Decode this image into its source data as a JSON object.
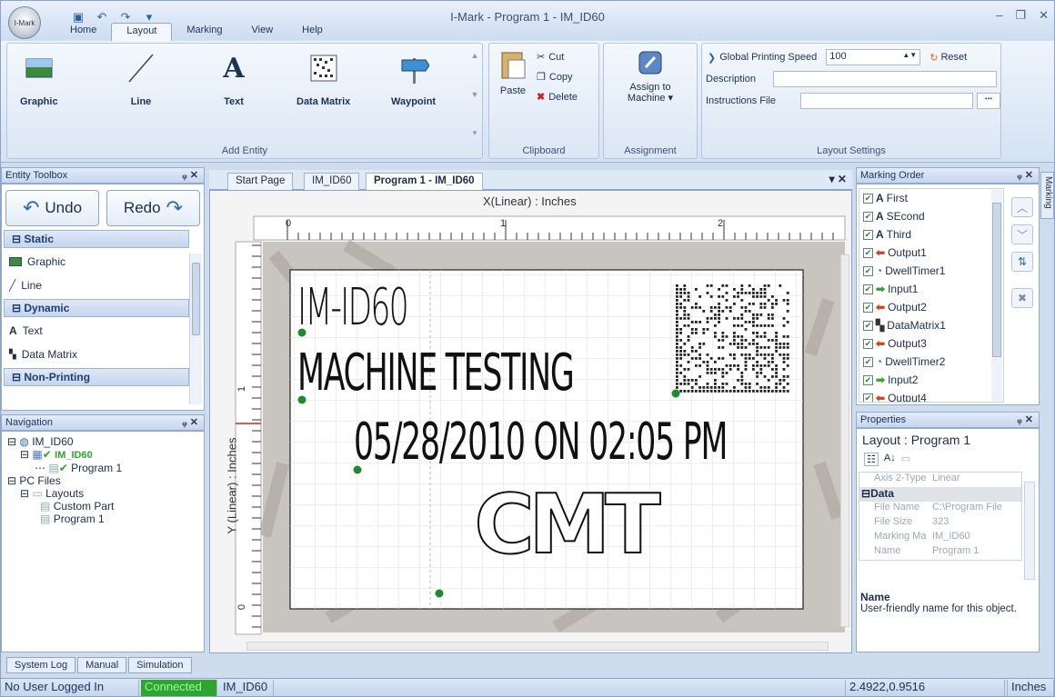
{
  "window": {
    "title": "I-Mark - Program 1 - IM_ID60",
    "orb_label": "I-Mark"
  },
  "tabs": [
    "Home",
    "Layout",
    "Marking",
    "View",
    "Help"
  ],
  "ribbon": {
    "add_entity": {
      "title": "Add Entity",
      "buttons": [
        "Graphic",
        "Line",
        "Text",
        "Data Matrix",
        "Waypoint"
      ]
    },
    "clipboard": {
      "title": "Clipboard",
      "paste": "Paste",
      "cut": "Cut",
      "copy": "Copy",
      "delete": "Delete"
    },
    "assignment": {
      "title": "Assignment",
      "assign_line1": "Assign to",
      "assign_line2": "Machine ▾"
    },
    "layout_settings": {
      "title": "Layout Settings",
      "speed_label": "Global Printing Speed",
      "speed_value": "100",
      "reset": "Reset",
      "description_label": "Description",
      "instructions_label": "Instructions File",
      "browse": "•••"
    }
  },
  "entity_toolbox": {
    "title": "Entity Toolbox",
    "undo": "Undo",
    "redo": "Redo",
    "sections": {
      "static": "Static",
      "dynamic": "Dynamic",
      "non_printing": "Non-Printing"
    },
    "static_items": [
      "Graphic",
      "Line"
    ],
    "dynamic_items": [
      "Text",
      "Data Matrix"
    ]
  },
  "navigation": {
    "title": "Navigation",
    "root": "IM_ID60",
    "machine": "IM_ID60",
    "program": "Program 1",
    "pc_files": "PC Files",
    "layouts": "Layouts",
    "layout_items": [
      "Custom Part",
      "Program 1"
    ]
  },
  "doc_tabs": [
    "Start Page",
    "IM_ID60",
    "Program 1 - IM_ID60"
  ],
  "canvas": {
    "x_axis_label": "X(Linear) : Inches",
    "y_axis_label": "Y (Linear) : Inches",
    "x_ticks": [
      "0",
      "1",
      "2"
    ],
    "y_ticks": [
      "1",
      "0"
    ],
    "line1": "IM-ID60",
    "line2": "MACHINE TESTING",
    "line3": "05/28/2010 ON 02:05 PM",
    "logo": "CMT"
  },
  "marking_order": {
    "title": "Marking Order",
    "side_tab": "Marking",
    "items": [
      {
        "label": "First",
        "icon": "text-icon"
      },
      {
        "label": "SEcond",
        "icon": "text-icon"
      },
      {
        "label": "Third",
        "icon": "text-icon"
      },
      {
        "label": "Output1",
        "icon": "output-icon"
      },
      {
        "label": "DwellTimer1",
        "icon": "timer-icon"
      },
      {
        "label": "Input1",
        "icon": "input-icon"
      },
      {
        "label": "Output2",
        "icon": "output-icon"
      },
      {
        "label": "DataMatrix1",
        "icon": "datamatrix-icon"
      },
      {
        "label": "Output3",
        "icon": "output-icon"
      },
      {
        "label": "DwellTimer2",
        "icon": "timer-icon"
      },
      {
        "label": "Input2",
        "icon": "input-icon"
      },
      {
        "label": "Output4",
        "icon": "output-icon"
      }
    ]
  },
  "properties": {
    "title": "Properties",
    "object": "Layout : Program 1",
    "rows_top": [
      {
        "k": "Axis 2-Type",
        "v": "Linear"
      }
    ],
    "category": "Data",
    "rows": [
      {
        "k": "File Name",
        "v": "C:\\Program File"
      },
      {
        "k": "File Size",
        "v": "323"
      },
      {
        "k": "Marking Ma",
        "v": "IM_ID60"
      },
      {
        "k": "Name",
        "v": "Program 1"
      }
    ],
    "desc_title": "Name",
    "desc_text": "User-friendly name for this object."
  },
  "bottom_tabs": [
    "System Log",
    "Manual",
    "Simulation"
  ],
  "status": {
    "user": "No User Logged In",
    "connection": "Connected",
    "machine": "IM_ID60",
    "coords": "2.4922,0.9516",
    "units": "Inches"
  },
  "colors": {
    "connected": "#2fa52f",
    "accent": "#3a6db5",
    "anchor_dot": "#1f8a2e"
  }
}
